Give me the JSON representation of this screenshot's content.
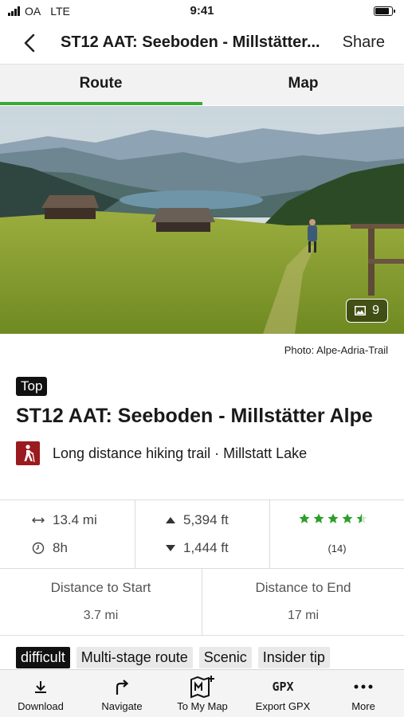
{
  "status_bar": {
    "carrier": "OA",
    "network": "LTE",
    "time": "9:41"
  },
  "nav": {
    "title": "ST12 AAT: Seeboden - Millstätter...",
    "share_label": "Share"
  },
  "tabs": [
    {
      "label": "Route",
      "active": true
    },
    {
      "label": "Map",
      "active": false
    }
  ],
  "colors": {
    "accent": "#3aa935",
    "category": "#9a1b1f",
    "star": "#2e9e2b"
  },
  "hero": {
    "photo_count": "9"
  },
  "photo_credit": "Photo: Alpe-Adria-Trail",
  "route": {
    "badge": "Top",
    "title": "ST12 AAT: Seeboden - Millstätter Alpe",
    "category_icon": "hiker-icon",
    "category": "Long distance hiking trail · Millstatt Lake"
  },
  "stats": {
    "distance": "13.4 mi",
    "duration": "8h",
    "ascent": "5,394 ft",
    "descent": "1,444 ft",
    "rating": 4.5,
    "rating_count": "(14)"
  },
  "distances": {
    "start_label": "Distance to Start",
    "start_value": "3.7 mi",
    "end_label": "Distance to End",
    "end_value": "17 mi"
  },
  "tags": [
    "difficult",
    "Multi-stage route",
    "Scenic",
    "Insider tip"
  ],
  "bottom_bar": [
    {
      "label": "Download",
      "icon": "download-icon"
    },
    {
      "label": "Navigate",
      "icon": "turn-right-arrow-icon"
    },
    {
      "label": "To My Map",
      "icon": "map-add-icon"
    },
    {
      "label": "Export GPX",
      "icon": "gpx-icon",
      "icon_text": "GPX"
    },
    {
      "label": "More",
      "icon": "ellipsis-icon"
    }
  ]
}
